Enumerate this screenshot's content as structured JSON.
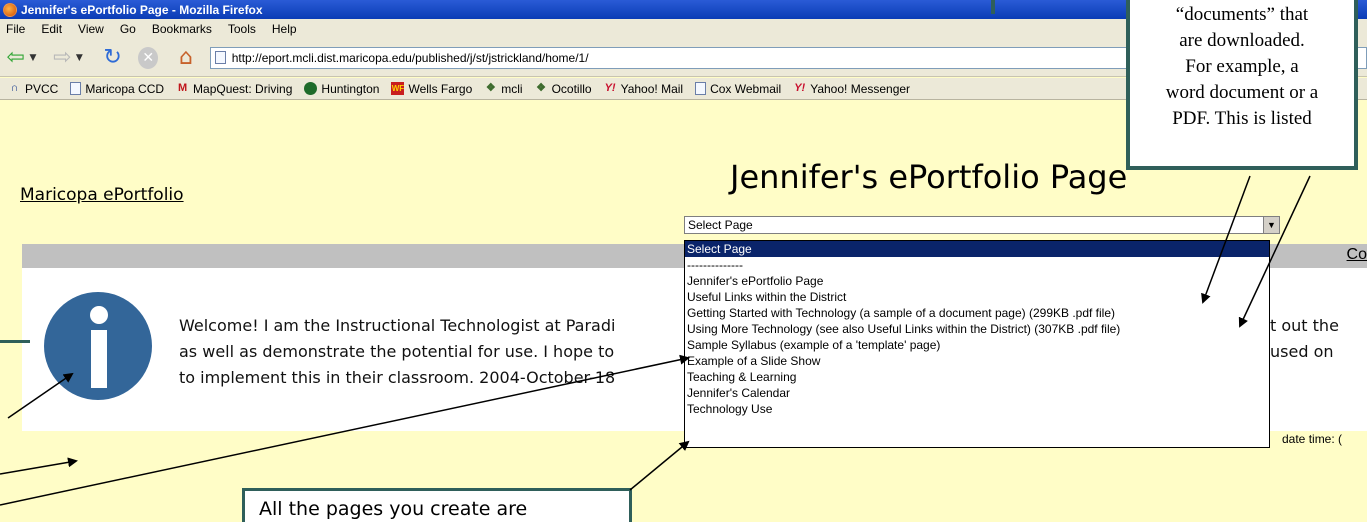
{
  "window": {
    "title": "Jennifer's ePortfolio Page - Mozilla Firefox"
  },
  "menu": [
    "File",
    "Edit",
    "View",
    "Go",
    "Bookmarks",
    "Tools",
    "Help"
  ],
  "address": {
    "url": "http://eport.mcli.dist.maricopa.edu/published/j/st/jstrickland/home/1/"
  },
  "bookmarks": [
    {
      "label": "PVCC",
      "icon": "pvcc-icon",
      "color": "#1a3d8f"
    },
    {
      "label": "Maricopa CCD",
      "icon": "page-icon",
      "color": "#6a7ea8"
    },
    {
      "label": "MapQuest: Driving",
      "icon": "mapquest-icon",
      "color": "#c0161b"
    },
    {
      "label": "Huntington",
      "icon": "huntington-icon",
      "color": "#1e6b2a"
    },
    {
      "label": "Wells Fargo",
      "icon": "wellsfargo-icon",
      "color": "#c81e1e"
    },
    {
      "label": "mcli",
      "icon": "book-icon",
      "color": "#3d6b2d"
    },
    {
      "label": "Ocotillo",
      "icon": "book-icon",
      "color": "#3d6b2d"
    },
    {
      "label": "Yahoo! Mail",
      "icon": "yahoo-icon",
      "color": "#c8102e"
    },
    {
      "label": "Cox Webmail",
      "icon": "page-icon",
      "color": "#6a7ea8"
    },
    {
      "label": "Yahoo! Messenger",
      "icon": "yahoo-icon",
      "color": "#c8102e"
    }
  ],
  "page": {
    "site_link": "Maricopa ePortfolio",
    "title": "Jennifer's ePortfolio Page",
    "select_value": "Select Page",
    "bar_link": "Co",
    "welcome_lines": [
      "Welcome! I am the Instructional Technologist at Paradi",
      "as well as demonstrate the potential for use. I hope to",
      "to implement this in their classroom. 2004-October-18"
    ],
    "welcome_right": [
      "t out the",
      "used on",
      ""
    ],
    "update_text": "date time: ("
  },
  "dropdown": {
    "options": [
      "Select Page",
      "--------------",
      "Jennifer's ePortfolio Page",
      "Useful Links within the District",
      "Getting Started with Technology (a sample of a document page) (299KB .pdf file)",
      "Using More Technology (see also Useful Links within the District) (307KB .pdf file)",
      "Sample Syllabus (example of a 'template' page)",
      "Example of a Slide Show",
      "Teaching & Learning",
      "Jennifer's Calendar",
      "Technology Use"
    ],
    "selected_index": 0
  },
  "callouts": {
    "top_lines": [
      "“documents” that",
      "are downloaded.",
      "For example, a",
      "word document or a",
      "PDF.  This is listed"
    ],
    "bottom_text": "All the pages you create are"
  },
  "colors": {
    "page_bg": "#fffdc7",
    "callout_border": "#2f5f5a",
    "info_icon": "#336699",
    "selection": "#0a246a"
  }
}
